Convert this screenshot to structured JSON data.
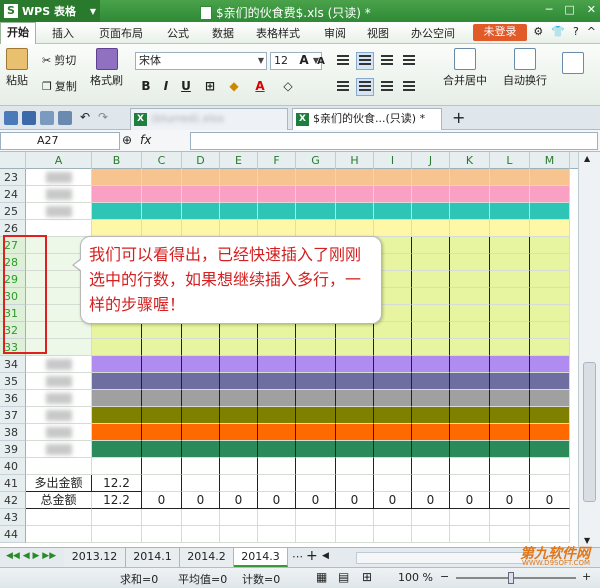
{
  "titlebar": {
    "app_name": "WPS 表格",
    "doc_title": "$亲们的伙食费$.xls (只读) *"
  },
  "menu": {
    "items": [
      "开始",
      "插入",
      "页面布局",
      "公式",
      "数据",
      "表格样式",
      "审阅",
      "视图",
      "办公空间"
    ],
    "login": "未登录"
  },
  "ribbon": {
    "paste": "粘贴",
    "cut": "剪切",
    "copy": "复制",
    "format_painter": "格式刷",
    "font_name": "宋体",
    "font_size": "12",
    "merge_center": "合并居中",
    "wrap_text": "自动换行"
  },
  "doc_tabs": [
    {
      "label": "(blurred).xlsx"
    },
    {
      "label": "$亲们的伙食...(只读) *"
    }
  ],
  "formula_bar": {
    "name_box": "A27",
    "fx": "fx",
    "value": ""
  },
  "columns": [
    "A",
    "B",
    "C",
    "D",
    "E",
    "F",
    "G",
    "H",
    "I",
    "J",
    "K",
    "L",
    "M"
  ],
  "rows": [
    "23",
    "24",
    "25",
    "26",
    "27",
    "28",
    "29",
    "30",
    "31",
    "32",
    "33",
    "34",
    "35",
    "36",
    "37",
    "38",
    "39",
    "40",
    "41",
    "42",
    "43",
    "44"
  ],
  "row41": {
    "a": "多出金额",
    "b": "12.2"
  },
  "row42": {
    "a": "总金额",
    "b": "12.2",
    "zeros": [
      "0",
      "0",
      "0",
      "0",
      "0",
      "0",
      "0",
      "0",
      "0",
      "0",
      "0"
    ]
  },
  "colors": {
    "peach": "#f7c38e",
    "pink": "#f9a0c4",
    "teal": "#2ec4b6",
    "lightyellow": "#fff7a8",
    "lime": "#e8f5a0",
    "purple": "#b08cf0",
    "slate": "#6e6ea0",
    "gray": "#a0a0a0",
    "olive": "#808000",
    "orange": "#ff6a00",
    "green": "#2a8a5a"
  },
  "callout": {
    "text": "我们可以看得出，已经快速插入了刚刚选中的行数，如果想继续插入多行，一样的步骤喔！"
  },
  "sheets": [
    "2013.12",
    "2014.1",
    "2014.2",
    "2014.3"
  ],
  "status": {
    "sum": "求和=0",
    "avg": "平均值=0",
    "count": "计数=0",
    "zoom": "100 %"
  },
  "watermark": {
    "brand": "第九软件网",
    "url": "WWW.D9SOFT.COM"
  }
}
